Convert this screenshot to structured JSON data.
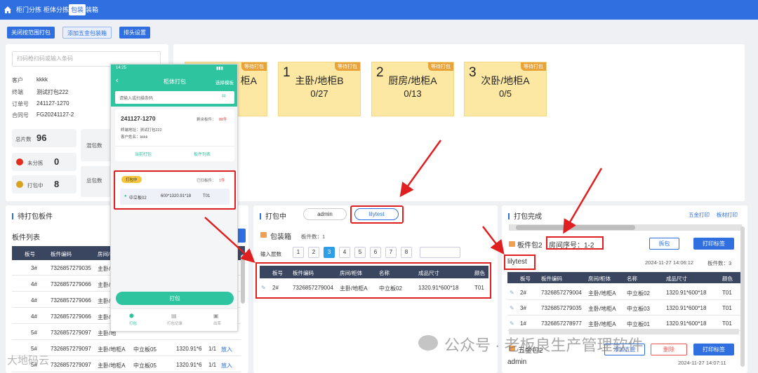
{
  "nav": {
    "tabs": [
      "柜门分拣",
      "柜体分拣",
      "包装",
      "装箱"
    ],
    "active_index": 2
  },
  "toolbar": {
    "close_scope": "关闭按范围打包",
    "add_hardware": "添加五金包装箱",
    "head_settings": "排头设置"
  },
  "scan": {
    "placeholder": "扫码枪扫码或输入条码"
  },
  "order": {
    "customer_label": "客户",
    "customer": "kkkk",
    "terminal_label": "终端",
    "terminal": "测试打包222",
    "order_no_label": "订单号",
    "order_no": "241127-1270",
    "contract_label": "合同号",
    "contract": "FG20241127-2"
  },
  "stats": {
    "total_label": "总片数",
    "total": "96",
    "mixed_label": "混包数",
    "unsorted_label": "未分拣",
    "unsorted": "0",
    "packing_label": "打包中",
    "packing": "8",
    "total_pack_label": "总包数"
  },
  "stickies": [
    {
      "num": "",
      "title": "柜A",
      "count": "",
      "tag": "等待打包"
    },
    {
      "num": "1",
      "title": "主卧/地柜B",
      "count": "0/27",
      "tag": "等待打包"
    },
    {
      "num": "2",
      "title": "厨房/地柜A",
      "count": "0/13",
      "tag": "等待打包"
    },
    {
      "num": "3",
      "title": "次卧/地柜A",
      "count": "0/5",
      "tag": "等待打包"
    }
  ],
  "left_list": {
    "section": "待打包板件",
    "subtitle": "板件列表",
    "headers": [
      "板号",
      "板件编码",
      "房间/柜体"
    ],
    "rows": [
      {
        "no": "3#",
        "code": "7326857279035",
        "room": "主卧/地"
      },
      {
        "no": "4#",
        "code": "7326857279066",
        "room": "主卧/地"
      },
      {
        "no": "4#",
        "code": "7326857279066",
        "room": "主卧/地"
      },
      {
        "no": "4#",
        "code": "7326857279066",
        "room": "主卧/地"
      },
      {
        "no": "5#",
        "code": "7326857279097",
        "room": "主卧/地"
      },
      {
        "no": "5#",
        "code": "7326857279097",
        "room": "主卧/地柜A",
        "name": "中立板05",
        "size": "1320.91*6",
        "qty": "1/1",
        "action": "放入"
      },
      {
        "no": "5#",
        "code": "7326857279097",
        "room": "主卧/地柜A",
        "name": "中立板05",
        "size": "1320.91*6",
        "qty": "1/1",
        "action": "放入"
      }
    ]
  },
  "packing": {
    "section": "打包中",
    "users": [
      "admin",
      "lilytest"
    ],
    "box_title": "包装箱",
    "box_count_label": "板件数：1",
    "layers_label": "输入层数",
    "pages": [
      "1",
      "2",
      "3",
      "4",
      "5",
      "6",
      "7",
      "8"
    ],
    "active_page": 2,
    "headers": [
      "板号",
      "板件编码",
      "房间/柜体",
      "名称",
      "成品尺寸",
      "颜色"
    ],
    "rows": [
      {
        "no": "2#",
        "code": "7326857279004",
        "room": "主卧/地柜A",
        "name": "中立板02",
        "size": "1320.91*600*18",
        "color": "T01"
      }
    ]
  },
  "done": {
    "section": "打包完成",
    "hardware_print": "五金打印",
    "board_print": "板材打印",
    "pack_title": "板件包2",
    "room_seq": "房间序号：1-2",
    "split": "拆包",
    "print_label": "打印标签",
    "user": "lilytest",
    "time": "2024-11-27 14:06:12",
    "count": "板件数：3",
    "headers": [
      "板号",
      "板件编码",
      "房间/柜体",
      "名称",
      "成品尺寸",
      "颜色"
    ],
    "rows": [
      {
        "no": "2#",
        "code": "7326857279004",
        "room": "主卧/地柜A",
        "name": "中立板02",
        "size": "1320.91*600*18",
        "color": "T01"
      },
      {
        "no": "3#",
        "code": "7326857279035",
        "room": "主卧/地柜A",
        "name": "中立板03",
        "size": "1320.91*600*18",
        "color": "T01"
      },
      {
        "no": "1#",
        "code": "7326857278977",
        "room": "主卧/地柜A",
        "name": "中立板01",
        "size": "1320.91*600*18",
        "color": "T01"
      }
    ],
    "hw_title": "五金包2",
    "hw_add": "添加五金",
    "hw_delete": "删除",
    "hw_print": "打印标签",
    "hw_user": "admin",
    "hw_time": "2024-11-27 14:07:11"
  },
  "phone": {
    "status_time": "14:25",
    "title": "柜体打包",
    "right": "选择模板",
    "scan_placeholder": "请输入或扫描条码",
    "order_no": "241127-1270",
    "remain": "剩余板件：",
    "remain_val": "88件",
    "terminal": "终端地址：测试打包222",
    "customer": "客户姓名：kkkk",
    "tab1": "当前打包",
    "tab2": "板件列表",
    "badge": "打包中",
    "scanned": "已扫板件：",
    "scanned_val": "1件",
    "item_name": "中立板02",
    "item_size": "600*1320.91*18",
    "item_color": "T01",
    "pack_btn": "打包",
    "nav": [
      "打包",
      "打包记录",
      "出库"
    ]
  },
  "watermark": {
    "left": "大地码云",
    "right": "公众号 · 老板良生产管理软件"
  },
  "colors": {
    "primary": "#2f6fe0",
    "highlight": "#e02020",
    "sticky": "#fde8a3",
    "teal": "#2ec4a0"
  }
}
